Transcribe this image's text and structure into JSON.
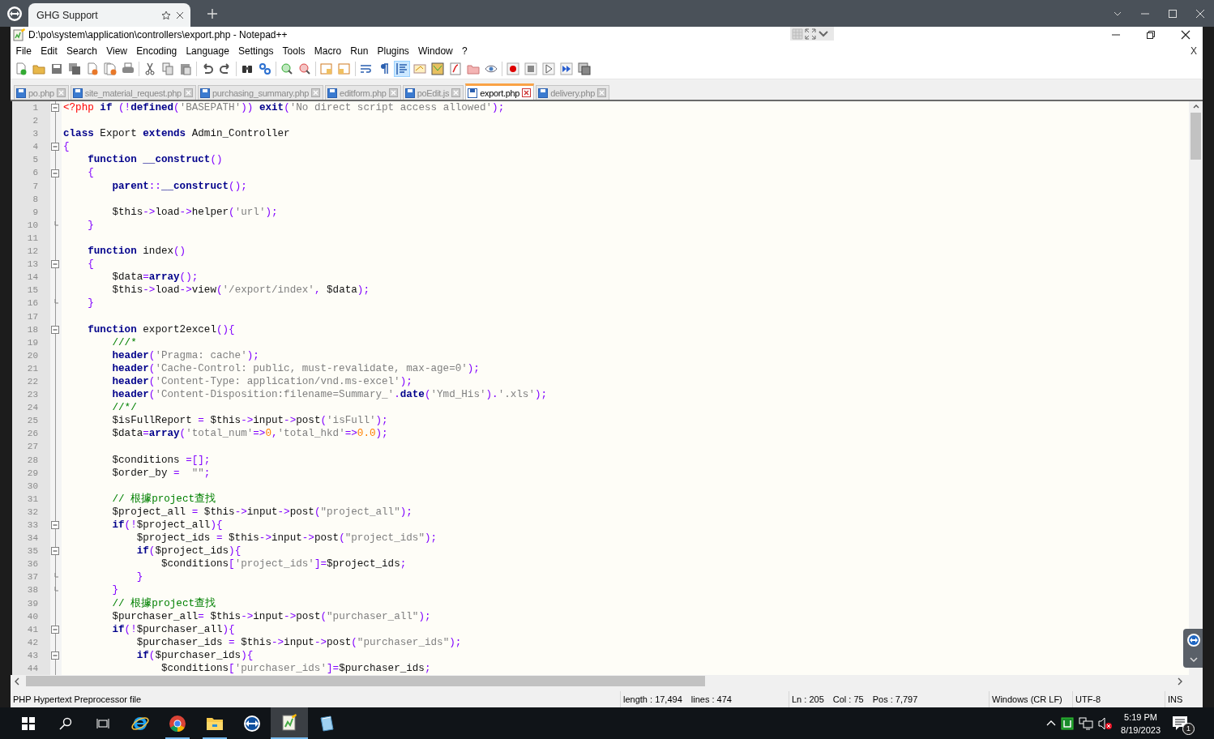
{
  "browser": {
    "tab_title": "GHG Support"
  },
  "window": {
    "title": "D:\\po\\system\\application\\controllers\\export.php - Notepad++"
  },
  "menu": [
    "File",
    "Edit",
    "Search",
    "View",
    "Encoding",
    "Language",
    "Settings",
    "Tools",
    "Macro",
    "Run",
    "Plugins",
    "Window",
    "?"
  ],
  "menu_close": "X",
  "toolbar": [
    {
      "kind": "new",
      "pressed": false
    },
    {
      "kind": "open",
      "pressed": false
    },
    {
      "kind": "save",
      "pressed": false
    },
    {
      "kind": "save_all",
      "pressed": false
    },
    {
      "kind": "close",
      "pressed": false
    },
    {
      "kind": "close_all",
      "pressed": false
    },
    {
      "kind": "print",
      "pressed": false
    },
    {
      "kind": "separator"
    },
    {
      "kind": "cut",
      "pressed": false
    },
    {
      "kind": "copy",
      "pressed": false
    },
    {
      "kind": "paste",
      "pressed": false
    },
    {
      "kind": "separator"
    },
    {
      "kind": "undo",
      "pressed": false
    },
    {
      "kind": "redo",
      "pressed": false
    },
    {
      "kind": "separator"
    },
    {
      "kind": "find",
      "pressed": false
    },
    {
      "kind": "replace",
      "pressed": false
    },
    {
      "kind": "separator"
    },
    {
      "kind": "zoom_in",
      "pressed": false
    },
    {
      "kind": "zoom_out",
      "pressed": false
    },
    {
      "kind": "separator"
    },
    {
      "kind": "sync_v",
      "pressed": false
    },
    {
      "kind": "sync_h",
      "pressed": false
    },
    {
      "kind": "separator"
    },
    {
      "kind": "wrap",
      "pressed": false
    },
    {
      "kind": "all_chars",
      "pressed": false
    },
    {
      "kind": "indent_guide",
      "pressed": true
    },
    {
      "kind": "lang_panel",
      "pressed": false
    },
    {
      "kind": "doc_map",
      "pressed": false
    },
    {
      "kind": "func_list",
      "pressed": false
    },
    {
      "kind": "folder_workspace",
      "pressed": false
    },
    {
      "kind": "monitor",
      "pressed": false
    },
    {
      "kind": "separator"
    },
    {
      "kind": "record",
      "pressed": false
    },
    {
      "kind": "stop",
      "pressed": false
    },
    {
      "kind": "play",
      "pressed": false
    },
    {
      "kind": "play_multi",
      "pressed": false
    },
    {
      "kind": "save_macro",
      "pressed": false
    }
  ],
  "document_tabs": [
    {
      "label": "po.php",
      "selected": false
    },
    {
      "label": "site_material_request.php",
      "selected": false
    },
    {
      "label": "purchasing_summary.php",
      "selected": false
    },
    {
      "label": "editform.php",
      "selected": false
    },
    {
      "label": "poEdit.js",
      "selected": false
    },
    {
      "label": "export.php",
      "selected": true
    },
    {
      "label": "delivery.php",
      "selected": false
    }
  ],
  "editor": {
    "lines": [
      {
        "number": "1",
        "fold_open": true,
        "fold_close": false,
        "tokens": [
          {
            "kind": "tag",
            "text": "<?php"
          },
          {
            "kind": "keyword",
            "text": " if"
          },
          {
            "kind": "operator",
            "text": " (!"
          },
          {
            "kind": "keyword",
            "text": "defined"
          },
          {
            "kind": "operator",
            "text": "("
          },
          {
            "kind": "string",
            "text": "'BASEPATH'"
          },
          {
            "kind": "operator",
            "text": "))"
          },
          {
            "kind": "keyword",
            "text": " exit"
          },
          {
            "kind": "operator",
            "text": "("
          },
          {
            "kind": "string",
            "text": "'No direct script access allowed'"
          },
          {
            "kind": "operator",
            "text": ");"
          }
        ]
      },
      {
        "number": "2",
        "fold_open": false,
        "fold_close": false
      },
      {
        "number": "3",
        "fold_open": false,
        "fold_close": false,
        "tokens": [
          {
            "kind": "keyword",
            "text": "class"
          },
          {
            "kind": "plain",
            "text": " Export "
          },
          {
            "kind": "keyword",
            "text": "extends"
          },
          {
            "kind": "plain",
            "text": " Admin_Controller"
          }
        ]
      },
      {
        "number": "4",
        "fold_open": true,
        "fold_close": false,
        "tokens": [
          {
            "kind": "operator",
            "text": "{"
          }
        ]
      },
      {
        "number": "5",
        "fold_open": false,
        "fold_close": false,
        "tokens": [
          {
            "kind": "keyword",
            "text": "    function"
          },
          {
            "kind": "keyword",
            "text": " __construct"
          },
          {
            "kind": "operator",
            "text": "()"
          }
        ]
      },
      {
        "number": "6",
        "fold_open": true,
        "fold_close": false,
        "tokens": [
          {
            "kind": "operator",
            "text": "    {"
          }
        ]
      },
      {
        "number": "7",
        "fold_open": false,
        "fold_close": false,
        "tokens": [
          {
            "kind": "keyword",
            "text": "        parent"
          },
          {
            "kind": "operator",
            "text": "::"
          },
          {
            "kind": "keyword",
            "text": "__construct"
          },
          {
            "kind": "operator",
            "text": "();"
          }
        ]
      },
      {
        "number": "8",
        "fold_open": false,
        "fold_close": false
      },
      {
        "number": "9",
        "fold_open": false,
        "fold_close": false,
        "tokens": [
          {
            "kind": "plain",
            "text": "        $this"
          },
          {
            "kind": "operator",
            "text": "->"
          },
          {
            "kind": "plain",
            "text": "load"
          },
          {
            "kind": "operator",
            "text": "->"
          },
          {
            "kind": "plain",
            "text": "helper"
          },
          {
            "kind": "operator",
            "text": "("
          },
          {
            "kind": "string",
            "text": "'url'"
          },
          {
            "kind": "operator",
            "text": ");"
          }
        ]
      },
      {
        "number": "10",
        "fold_open": false,
        "fold_close": true,
        "tokens": [
          {
            "kind": "operator",
            "text": "    }"
          }
        ]
      },
      {
        "number": "11",
        "fold_open": false,
        "fold_close": false
      },
      {
        "number": "12",
        "fold_open": false,
        "fold_close": false,
        "tokens": [
          {
            "kind": "keyword",
            "text": "    function"
          },
          {
            "kind": "plain",
            "text": " index"
          },
          {
            "kind": "operator",
            "text": "()"
          }
        ]
      },
      {
        "number": "13",
        "fold_open": true,
        "fold_close": false,
        "tokens": [
          {
            "kind": "operator",
            "text": "    {"
          }
        ]
      },
      {
        "number": "14",
        "fold_open": false,
        "fold_close": false,
        "tokens": [
          {
            "kind": "plain",
            "text": "        $data"
          },
          {
            "kind": "operator",
            "text": "="
          },
          {
            "kind": "keyword",
            "text": "array"
          },
          {
            "kind": "operator",
            "text": "();"
          }
        ]
      },
      {
        "number": "15",
        "fold_open": false,
        "fold_close": false,
        "tokens": [
          {
            "kind": "plain",
            "text": "        $this"
          },
          {
            "kind": "operator",
            "text": "->"
          },
          {
            "kind": "plain",
            "text": "load"
          },
          {
            "kind": "operator",
            "text": "->"
          },
          {
            "kind": "plain",
            "text": "view"
          },
          {
            "kind": "operator",
            "text": "("
          },
          {
            "kind": "string",
            "text": "'/export/index'"
          },
          {
            "kind": "operator",
            "text": ","
          },
          {
            "kind": "plain",
            "text": " $data"
          },
          {
            "kind": "operator",
            "text": ");"
          }
        ]
      },
      {
        "number": "16",
        "fold_open": false,
        "fold_close": true,
        "tokens": [
          {
            "kind": "operator",
            "text": "    }"
          }
        ]
      },
      {
        "number": "17",
        "fold_open": false,
        "fold_close": false
      },
      {
        "number": "18",
        "fold_open": true,
        "fold_close": false,
        "tokens": [
          {
            "kind": "keyword",
            "text": "    function"
          },
          {
            "kind": "plain",
            "text": " export2excel"
          },
          {
            "kind": "operator",
            "text": "(){"
          }
        ]
      },
      {
        "number": "19",
        "fold_open": false,
        "fold_close": false,
        "tokens": [
          {
            "kind": "comment",
            "text": "        ///*"
          }
        ]
      },
      {
        "number": "20",
        "fold_open": false,
        "fold_close": false,
        "tokens": [
          {
            "kind": "keyword",
            "text": "        header"
          },
          {
            "kind": "operator",
            "text": "("
          },
          {
            "kind": "string",
            "text": "'Pragma: cache'"
          },
          {
            "kind": "operator",
            "text": ");"
          }
        ]
      },
      {
        "number": "21",
        "fold_open": false,
        "fold_close": false,
        "tokens": [
          {
            "kind": "keyword",
            "text": "        header"
          },
          {
            "kind": "operator",
            "text": "("
          },
          {
            "kind": "string",
            "text": "'Cache-Control: public, must-revalidate, max-age=0'"
          },
          {
            "kind": "operator",
            "text": ");"
          }
        ]
      },
      {
        "number": "22",
        "fold_open": false,
        "fold_close": false,
        "tokens": [
          {
            "kind": "keyword",
            "text": "        header"
          },
          {
            "kind": "operator",
            "text": "("
          },
          {
            "kind": "string",
            "text": "'Content-Type: application/vnd.ms-excel'"
          },
          {
            "kind": "operator",
            "text": ");"
          }
        ]
      },
      {
        "number": "23",
        "fold_open": false,
        "fold_close": false,
        "tokens": [
          {
            "kind": "keyword",
            "text": "        header"
          },
          {
            "kind": "operator",
            "text": "("
          },
          {
            "kind": "string",
            "text": "'Content-Disposition:filename=Summary_'"
          },
          {
            "kind": "operator",
            "text": "."
          },
          {
            "kind": "keyword",
            "text": "date"
          },
          {
            "kind": "operator",
            "text": "("
          },
          {
            "kind": "string",
            "text": "'Ymd_His'"
          },
          {
            "kind": "operator",
            "text": ")."
          },
          {
            "kind": "string",
            "text": "'.xls'"
          },
          {
            "kind": "operator",
            "text": ");"
          }
        ]
      },
      {
        "number": "24",
        "fold_open": false,
        "fold_close": false,
        "tokens": [
          {
            "kind": "comment",
            "text": "        //*/"
          }
        ]
      },
      {
        "number": "25",
        "fold_open": false,
        "fold_close": false,
        "tokens": [
          {
            "kind": "plain",
            "text": "        $isFullReport "
          },
          {
            "kind": "operator",
            "text": "="
          },
          {
            "kind": "plain",
            "text": " $this"
          },
          {
            "kind": "operator",
            "text": "->"
          },
          {
            "kind": "plain",
            "text": "input"
          },
          {
            "kind": "operator",
            "text": "->"
          },
          {
            "kind": "plain",
            "text": "post"
          },
          {
            "kind": "operator",
            "text": "("
          },
          {
            "kind": "string",
            "text": "'isFull'"
          },
          {
            "kind": "operator",
            "text": ");"
          }
        ]
      },
      {
        "number": "26",
        "fold_open": false,
        "fold_close": false,
        "tokens": [
          {
            "kind": "plain",
            "text": "        $data"
          },
          {
            "kind": "operator",
            "text": "="
          },
          {
            "kind": "keyword",
            "text": "array"
          },
          {
            "kind": "operator",
            "text": "("
          },
          {
            "kind": "string",
            "text": "'total_num'"
          },
          {
            "kind": "operator",
            "text": "=>"
          },
          {
            "kind": "number",
            "text": "0"
          },
          {
            "kind": "operator",
            "text": ","
          },
          {
            "kind": "string",
            "text": "'total_hkd'"
          },
          {
            "kind": "operator",
            "text": "=>"
          },
          {
            "kind": "number",
            "text": "0.0"
          },
          {
            "kind": "operator",
            "text": ");"
          }
        ]
      },
      {
        "number": "27",
        "fold_open": false,
        "fold_close": false
      },
      {
        "number": "28",
        "fold_open": false,
        "fold_close": false,
        "tokens": [
          {
            "kind": "plain",
            "text": "        $conditions "
          },
          {
            "kind": "operator",
            "text": "=[];"
          }
        ]
      },
      {
        "number": "29",
        "fold_open": false,
        "fold_close": false,
        "tokens": [
          {
            "kind": "plain",
            "text": "        $order_by "
          },
          {
            "kind": "operator",
            "text": "="
          },
          {
            "kind": "string",
            "text": "  \"\""
          },
          {
            "kind": "operator",
            "text": ";"
          }
        ]
      },
      {
        "number": "30",
        "fold_open": false,
        "fold_close": false
      },
      {
        "number": "31",
        "fold_open": false,
        "fold_close": false,
        "tokens": [
          {
            "kind": "comment",
            "text": "        // 根據project查找"
          }
        ]
      },
      {
        "number": "32",
        "fold_open": false,
        "fold_close": false,
        "tokens": [
          {
            "kind": "plain",
            "text": "        $project_all "
          },
          {
            "kind": "operator",
            "text": "="
          },
          {
            "kind": "plain",
            "text": " $this"
          },
          {
            "kind": "operator",
            "text": "->"
          },
          {
            "kind": "plain",
            "text": "input"
          },
          {
            "kind": "operator",
            "text": "->"
          },
          {
            "kind": "plain",
            "text": "post"
          },
          {
            "kind": "operator",
            "text": "("
          },
          {
            "kind": "string",
            "text": "\"project_all\""
          },
          {
            "kind": "operator",
            "text": ");"
          }
        ]
      },
      {
        "number": "33",
        "fold_open": true,
        "fold_close": false,
        "tokens": [
          {
            "kind": "keyword",
            "text": "        if"
          },
          {
            "kind": "operator",
            "text": "(!"
          },
          {
            "kind": "plain",
            "text": "$project_all"
          },
          {
            "kind": "operator",
            "text": "){"
          }
        ]
      },
      {
        "number": "34",
        "fold_open": false,
        "fold_close": false,
        "tokens": [
          {
            "kind": "plain",
            "text": "            $project_ids "
          },
          {
            "kind": "operator",
            "text": "="
          },
          {
            "kind": "plain",
            "text": " $this"
          },
          {
            "kind": "operator",
            "text": "->"
          },
          {
            "kind": "plain",
            "text": "input"
          },
          {
            "kind": "operator",
            "text": "->"
          },
          {
            "kind": "plain",
            "text": "post"
          },
          {
            "kind": "operator",
            "text": "("
          },
          {
            "kind": "string",
            "text": "\"project_ids\""
          },
          {
            "kind": "operator",
            "text": ");"
          }
        ]
      },
      {
        "number": "35",
        "fold_open": true,
        "fold_close": false,
        "tokens": [
          {
            "kind": "keyword",
            "text": "            if"
          },
          {
            "kind": "operator",
            "text": "("
          },
          {
            "kind": "plain",
            "text": "$project_ids"
          },
          {
            "kind": "operator",
            "text": "){"
          }
        ]
      },
      {
        "number": "36",
        "fold_open": false,
        "fold_close": false,
        "tokens": [
          {
            "kind": "plain",
            "text": "                $conditions"
          },
          {
            "kind": "operator",
            "text": "["
          },
          {
            "kind": "string",
            "text": "'project_ids'"
          },
          {
            "kind": "operator",
            "text": "]="
          },
          {
            "kind": "plain",
            "text": "$project_ids"
          },
          {
            "kind": "operator",
            "text": ";"
          }
        ]
      },
      {
        "number": "37",
        "fold_open": false,
        "fold_close": true,
        "tokens": [
          {
            "kind": "operator",
            "text": "            }"
          }
        ]
      },
      {
        "number": "38",
        "fold_open": false,
        "fold_close": true,
        "tokens": [
          {
            "kind": "operator",
            "text": "        }"
          }
        ]
      },
      {
        "number": "39",
        "fold_open": false,
        "fold_close": false,
        "tokens": [
          {
            "kind": "comment",
            "text": "        // 根據project查找"
          }
        ]
      },
      {
        "number": "40",
        "fold_open": false,
        "fold_close": false,
        "tokens": [
          {
            "kind": "plain",
            "text": "        $purchaser_all"
          },
          {
            "kind": "operator",
            "text": "="
          },
          {
            "kind": "plain",
            "text": " $this"
          },
          {
            "kind": "operator",
            "text": "->"
          },
          {
            "kind": "plain",
            "text": "input"
          },
          {
            "kind": "operator",
            "text": "->"
          },
          {
            "kind": "plain",
            "text": "post"
          },
          {
            "kind": "operator",
            "text": "("
          },
          {
            "kind": "string",
            "text": "\"purchaser_all\""
          },
          {
            "kind": "operator",
            "text": ");"
          }
        ]
      },
      {
        "number": "41",
        "fold_open": true,
        "fold_close": false,
        "tokens": [
          {
            "kind": "keyword",
            "text": "        if"
          },
          {
            "kind": "operator",
            "text": "(!"
          },
          {
            "kind": "plain",
            "text": "$purchaser_all"
          },
          {
            "kind": "operator",
            "text": "){"
          }
        ]
      },
      {
        "number": "42",
        "fold_open": false,
        "fold_close": false,
        "tokens": [
          {
            "kind": "plain",
            "text": "            $purchaser_ids "
          },
          {
            "kind": "operator",
            "text": "="
          },
          {
            "kind": "plain",
            "text": " $this"
          },
          {
            "kind": "operator",
            "text": "->"
          },
          {
            "kind": "plain",
            "text": "input"
          },
          {
            "kind": "operator",
            "text": "->"
          },
          {
            "kind": "plain",
            "text": "post"
          },
          {
            "kind": "operator",
            "text": "("
          },
          {
            "kind": "string",
            "text": "\"purchaser_ids\""
          },
          {
            "kind": "operator",
            "text": ");"
          }
        ]
      },
      {
        "number": "43",
        "fold_open": true,
        "fold_close": false,
        "tokens": [
          {
            "kind": "keyword",
            "text": "            if"
          },
          {
            "kind": "operator",
            "text": "("
          },
          {
            "kind": "plain",
            "text": "$purchaser_ids"
          },
          {
            "kind": "operator",
            "text": "){"
          }
        ]
      },
      {
        "number": "44",
        "fold_open": false,
        "fold_close": false,
        "tokens": [
          {
            "kind": "plain",
            "text": "                $conditions"
          },
          {
            "kind": "operator",
            "text": "["
          },
          {
            "kind": "string",
            "text": "'purchaser_ids'"
          },
          {
            "kind": "operator",
            "text": "]="
          },
          {
            "kind": "plain",
            "text": "$purchaser_ids"
          },
          {
            "kind": "operator",
            "text": ";"
          }
        ]
      }
    ]
  },
  "status_bar": [
    {
      "items": [
        "PHP Hypertext Preprocessor file"
      ]
    },
    {
      "items": [
        "length : 17,494",
        "lines : 474"
      ]
    },
    {
      "items": [
        "Ln : 205",
        "Col : 75",
        "Pos : 7,797"
      ]
    },
    {
      "items": [
        "Windows (CR LF)"
      ]
    },
    {
      "items": [
        "UTF-8"
      ]
    },
    {
      "items": [
        "INS"
      ]
    }
  ],
  "taskbar": {
    "apps": [
      {
        "kind": "browser_e",
        "running": false,
        "selected": false
      },
      {
        "kind": "browser_round",
        "running": true,
        "selected": false
      },
      {
        "kind": "file_manager",
        "running": true,
        "selected": false
      },
      {
        "kind": "remote",
        "running": false,
        "selected": false
      },
      {
        "kind": "text_editor",
        "running": true,
        "selected": true
      },
      {
        "kind": "notebook",
        "running": false,
        "selected": false
      }
    ],
    "time": "5:19 PM",
    "date": "8/19/2023",
    "notification_count": "1"
  }
}
